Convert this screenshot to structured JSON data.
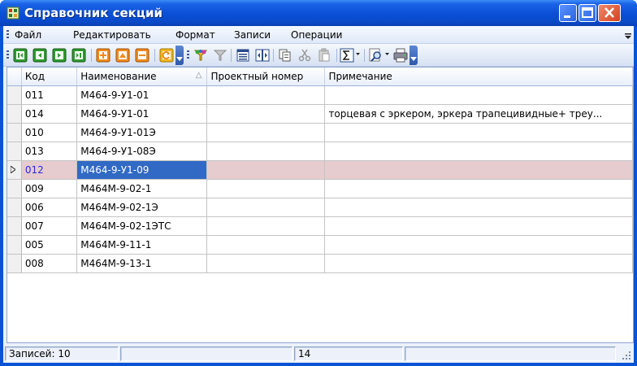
{
  "window": {
    "title": "Справочник секций"
  },
  "menu": {
    "items": [
      "Файл",
      "Редактировать",
      "Формат",
      "Записи",
      "Операции"
    ]
  },
  "toolbar": {
    "buttons": [
      {
        "icon": "first-record-icon"
      },
      {
        "icon": "prev-page-icon"
      },
      {
        "icon": "next-page-icon"
      },
      {
        "icon": "last-record-icon"
      },
      {
        "icon": "add-record-icon"
      },
      {
        "icon": "edit-record-icon"
      },
      {
        "icon": "delete-record-icon"
      },
      {
        "icon": "refresh-icon"
      },
      {
        "icon": "filter-icon"
      },
      {
        "icon": "remove-filter-icon"
      },
      {
        "icon": "form-view-icon"
      },
      {
        "icon": "columns-icon"
      },
      {
        "icon": "copy-icon"
      },
      {
        "icon": "cut-icon"
      },
      {
        "icon": "paste-icon"
      },
      {
        "icon": "sum-icon"
      },
      {
        "icon": "find-icon"
      },
      {
        "icon": "print-icon"
      }
    ]
  },
  "grid": {
    "columns": [
      "Код",
      "Наименование",
      "Проектный номер",
      "Примечание"
    ],
    "sort_indicator": "△",
    "rows": [
      {
        "code": "011",
        "name": "М464-9-У1-01",
        "project": "",
        "note": ""
      },
      {
        "code": "014",
        "name": "М464-9-У1-01",
        "project": "",
        "note": "торцевая с эркером, эркера трапецивидные+ треу..."
      },
      {
        "code": "010",
        "name": "М464-9-У1-01Э",
        "project": "",
        "note": ""
      },
      {
        "code": "013",
        "name": "М464-9-У1-08Э",
        "project": "",
        "note": ""
      },
      {
        "code": "012",
        "name": "М464-9-У1-09",
        "project": "",
        "note": ""
      },
      {
        "code": "009",
        "name": "М464М-9-02-1",
        "project": "",
        "note": ""
      },
      {
        "code": "006",
        "name": "М464М-9-02-1Э",
        "project": "",
        "note": ""
      },
      {
        "code": "007",
        "name": "М464М-9-02-1ЭТС",
        "project": "",
        "note": ""
      },
      {
        "code": "005",
        "name": "М464М-9-11-1",
        "project": "",
        "note": ""
      },
      {
        "code": "008",
        "name": "М464М-9-13-1",
        "project": "",
        "note": ""
      }
    ],
    "selected_row": 4
  },
  "status": {
    "records": "Записей: 10",
    "panel3": "14"
  },
  "colors": {
    "title_blue": "#0a4fd6",
    "selected_row": "#e6cccf",
    "focus_cell": "#316ac5"
  }
}
